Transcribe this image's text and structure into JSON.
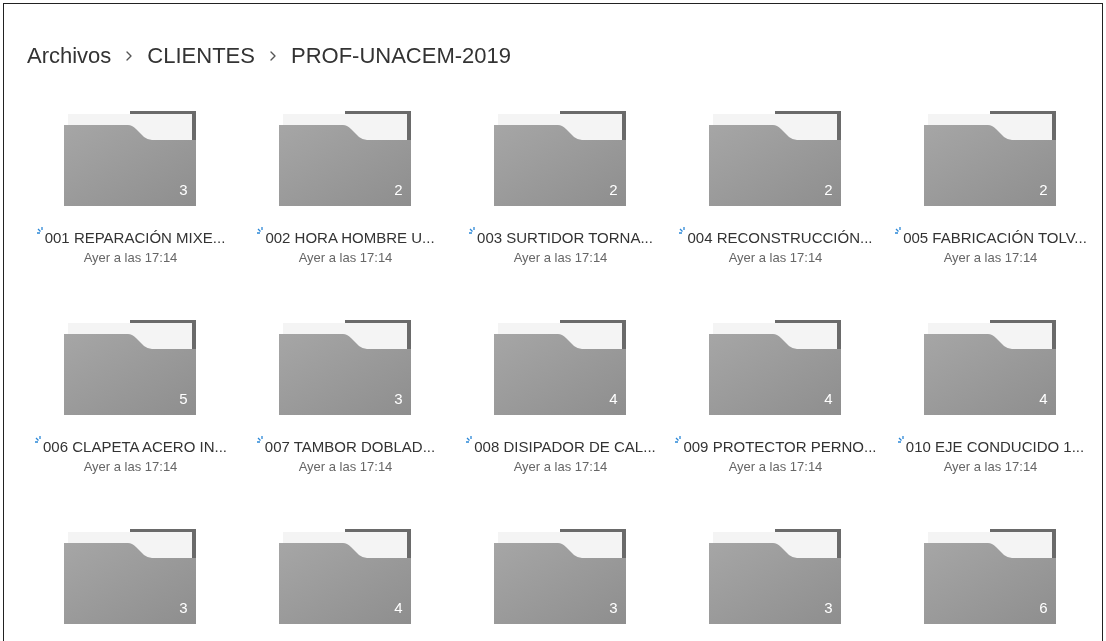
{
  "breadcrumb": [
    "Archivos",
    "CLIENTES",
    "PROF-UNACEM-2019"
  ],
  "folders": [
    {
      "name": "001 REPARACIÓN MIXE...",
      "date": "Ayer a las 17:14",
      "count": "3",
      "syncing": true
    },
    {
      "name": "002 HORA HOMBRE U...",
      "date": "Ayer a las 17:14",
      "count": "2",
      "syncing": true
    },
    {
      "name": "003 SURTIDOR TORNA...",
      "date": "Ayer a las 17:14",
      "count": "2",
      "syncing": true
    },
    {
      "name": "004 RECONSTRUCCIÓN...",
      "date": "Ayer a las 17:14",
      "count": "2",
      "syncing": true
    },
    {
      "name": "005 FABRICACIÓN TOLV...",
      "date": "Ayer a las 17:14",
      "count": "2",
      "syncing": true
    },
    {
      "name": "006 CLAPETA ACERO IN...",
      "date": "Ayer a las 17:14",
      "count": "5",
      "syncing": true
    },
    {
      "name": "007 TAMBOR DOBLAD...",
      "date": "Ayer a las 17:14",
      "count": "3",
      "syncing": true
    },
    {
      "name": "008 DISIPADOR DE CAL...",
      "date": "Ayer a las 17:14",
      "count": "4",
      "syncing": true
    },
    {
      "name": "009 PROTECTOR PERNO...",
      "date": "Ayer a las 17:14",
      "count": "4",
      "syncing": true
    },
    {
      "name": "010 EJE CONDUCIDO 1...",
      "date": "Ayer a las 17:14",
      "count": "4",
      "syncing": true
    },
    {
      "count": "3"
    },
    {
      "count": "4"
    },
    {
      "count": "3"
    },
    {
      "count": "3"
    },
    {
      "count": "6"
    }
  ]
}
